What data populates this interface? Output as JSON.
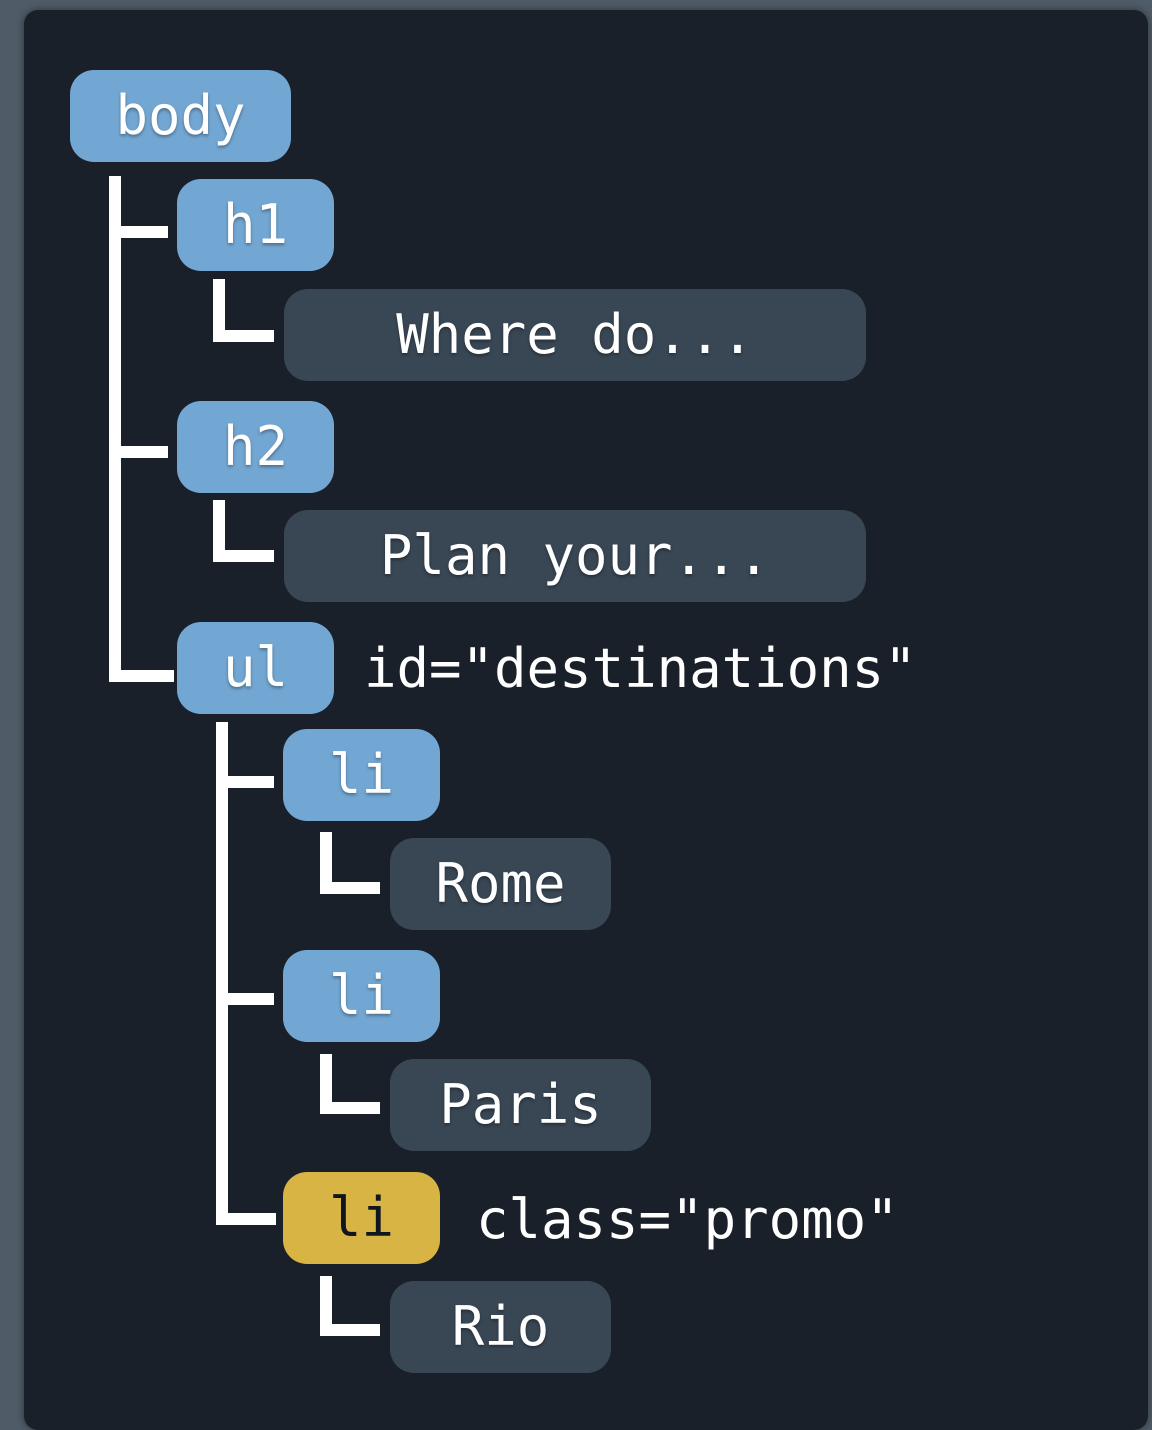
{
  "tree": {
    "body": "body",
    "h1": "h1",
    "h1_text": "Where do...",
    "h2": "h2",
    "h2_text": "Plan your...",
    "ul": "ul",
    "ul_attr": "id=\"destinations\"",
    "li1": "li",
    "li1_text": "Rome",
    "li2": "li",
    "li2_text": "Paris",
    "li3": "li",
    "li3_attr": "class=\"promo\"",
    "li3_text": "Rio"
  },
  "colors": {
    "panel": "#1a2029",
    "tag": "#73a7d3",
    "highlight_tag": "#d8b445",
    "text_node": "#394755",
    "connector": "#ffffff"
  }
}
